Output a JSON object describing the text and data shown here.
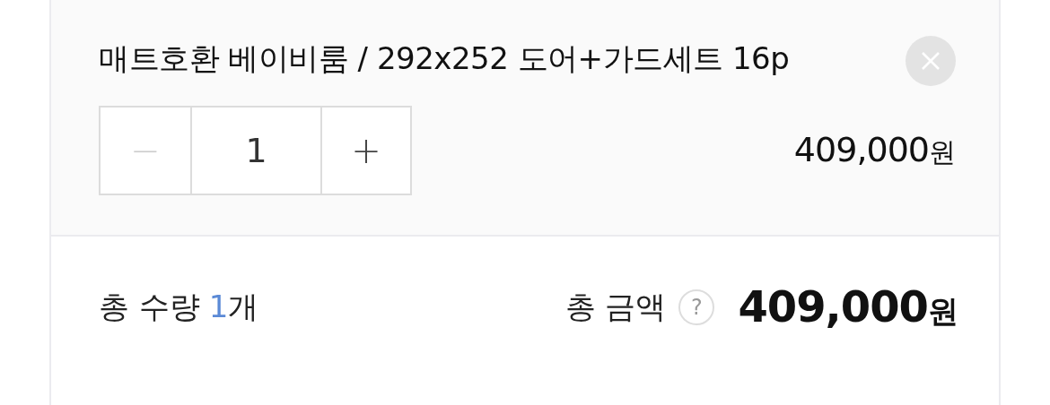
{
  "option": {
    "title": "매트호환 베이비룸 / 292x252 도어+가드세트 16p",
    "quantity": {
      "decrease": "−",
      "value": "1",
      "increase": "+"
    },
    "price": {
      "amount": "409,000",
      "currency": "원"
    }
  },
  "summary": {
    "quantity_label": "총 수량",
    "quantity_count": "1",
    "quantity_unit": "개",
    "total_label": "총 금액",
    "help": "?",
    "total": {
      "amount": "409,000",
      "currency": "원"
    }
  }
}
